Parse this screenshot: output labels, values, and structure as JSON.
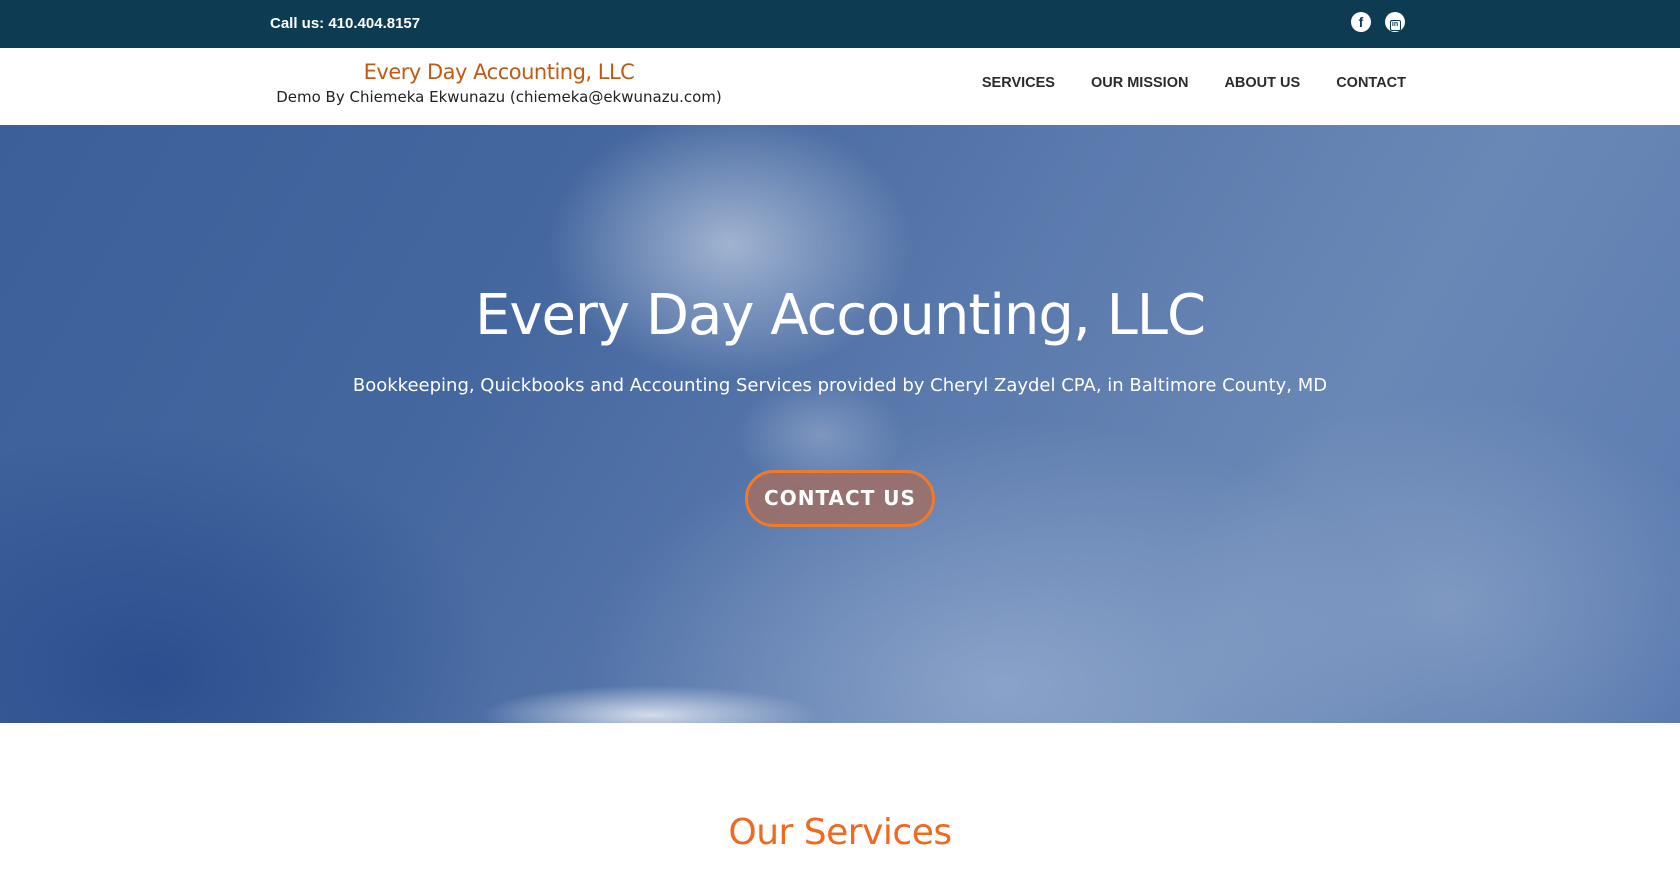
{
  "topbar": {
    "call_text": "Call us: 410.404.8157",
    "social": [
      {
        "icon": "facebook-icon",
        "glyph": "f"
      },
      {
        "icon": "linkedin-icon",
        "glyph": "in"
      }
    ]
  },
  "header": {
    "brand_name": "Every Day Accounting, LLC",
    "tagline": "Demo By Chiemeka Ekwunazu (chiemeka@ekwunazu.com)",
    "nav": {
      "services": "SERVICES",
      "mission": "OUR MISSION",
      "about": "ABOUT US",
      "contact": "CONTACT"
    }
  },
  "hero": {
    "title": "Every Day Accounting, LLC",
    "subtitle": "Bookkeeping, Quickbooks and Accounting Services provided by Cheryl Zaydel CPA, in Baltimore County, MD",
    "cta_label": "CONTACT US"
  },
  "services": {
    "title": "Our Services"
  },
  "colors": {
    "topbar_bg": "#0c3b52",
    "brand_orange": "#c25a14",
    "accent_orange": "#ee6a21",
    "cta_border": "#f07a2a"
  }
}
